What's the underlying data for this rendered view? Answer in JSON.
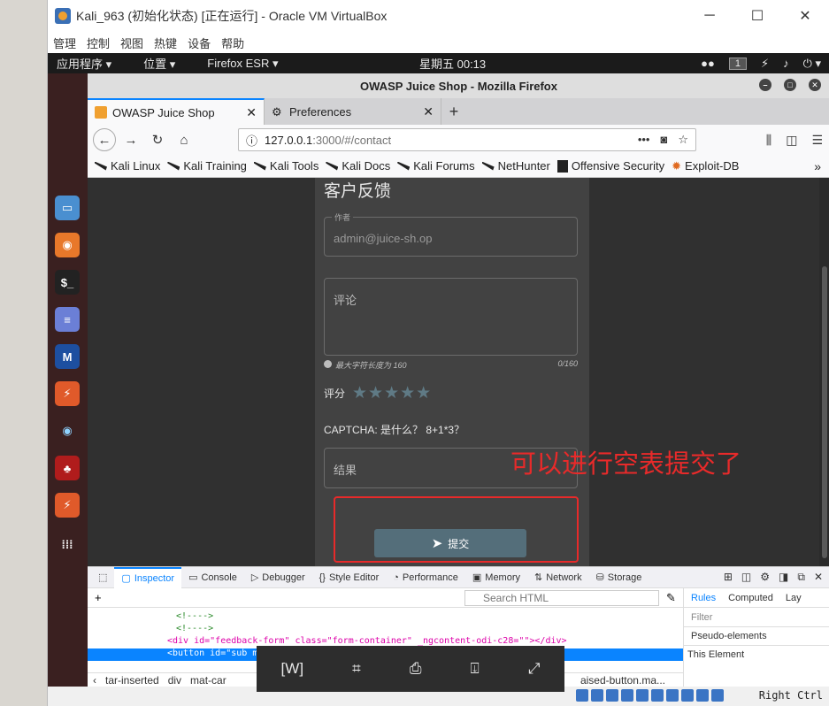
{
  "vbox": {
    "title": "Kali_963 (初始化状态) [正在运行] - Oracle VM VirtualBox",
    "minimize": "─",
    "maximize": "☐",
    "close": "✕",
    "menu": [
      "管理",
      "控制",
      "视图",
      "热键",
      "设备",
      "帮助"
    ]
  },
  "kali_panel": {
    "apps_menu": "应用程序 ▾",
    "places_menu": "位置 ▾",
    "firefox_menu": "Firefox ESR ▾",
    "clock": "星期五 00:13",
    "workspace": "1"
  },
  "firefox": {
    "window_title": "OWASP Juice Shop - Mozilla Firefox",
    "tabs": [
      {
        "label": "OWASP Juice Shop",
        "active": true
      },
      {
        "label": "Preferences",
        "active": false
      }
    ],
    "url_host": "127.0.0.1",
    "url_path": ":3000/#/contact",
    "bookmarks": [
      "Kali Linux",
      "Kali Training",
      "Kali Tools",
      "Kali Docs",
      "Kali Forums",
      "NetHunter",
      "Offensive Security",
      "Exploit-DB"
    ]
  },
  "page": {
    "heading": "客户反馈",
    "author_label": "作者",
    "author_value": "admin@juice-sh.op",
    "comment_placeholder": "评论",
    "max_len_hint": "最大字符长度为 160",
    "char_count": "0/160",
    "rating_label": "评分",
    "stars": "★★★★★",
    "rating_value": 0,
    "captcha_label": "CAPTCHA: 是什么？ 8+1*3？",
    "result_placeholder": "结果",
    "submit_label": "提交",
    "annotation": "可以进行空表提交了"
  },
  "devtools": {
    "tabs": [
      "Inspector",
      "Console",
      "Debugger",
      "Style Editor",
      "Performance",
      "Memory",
      "Network",
      "Storage"
    ],
    "search_placeholder": "Search HTML",
    "code_lines": [
      "<!---->",
      "<!---->",
      "<div id=\"feedback-form\" class=\"form-container\" _ngcontent-odi-c28=\"\"></div>",
      "<button id=\"sub                                      mary\" _ngcontent-"
    ],
    "breadcrumbs": [
      "tar-inserted",
      "div",
      "mat-car",
      "aised-button.ma..."
    ],
    "side_tabs": [
      "Rules",
      "Computed",
      "Lay"
    ],
    "filter_placeholder": "Filter",
    "side_items": [
      "Pseudo-elements",
      "This Element"
    ]
  },
  "host_status": {
    "right_ctrl": "Right Ctrl"
  }
}
